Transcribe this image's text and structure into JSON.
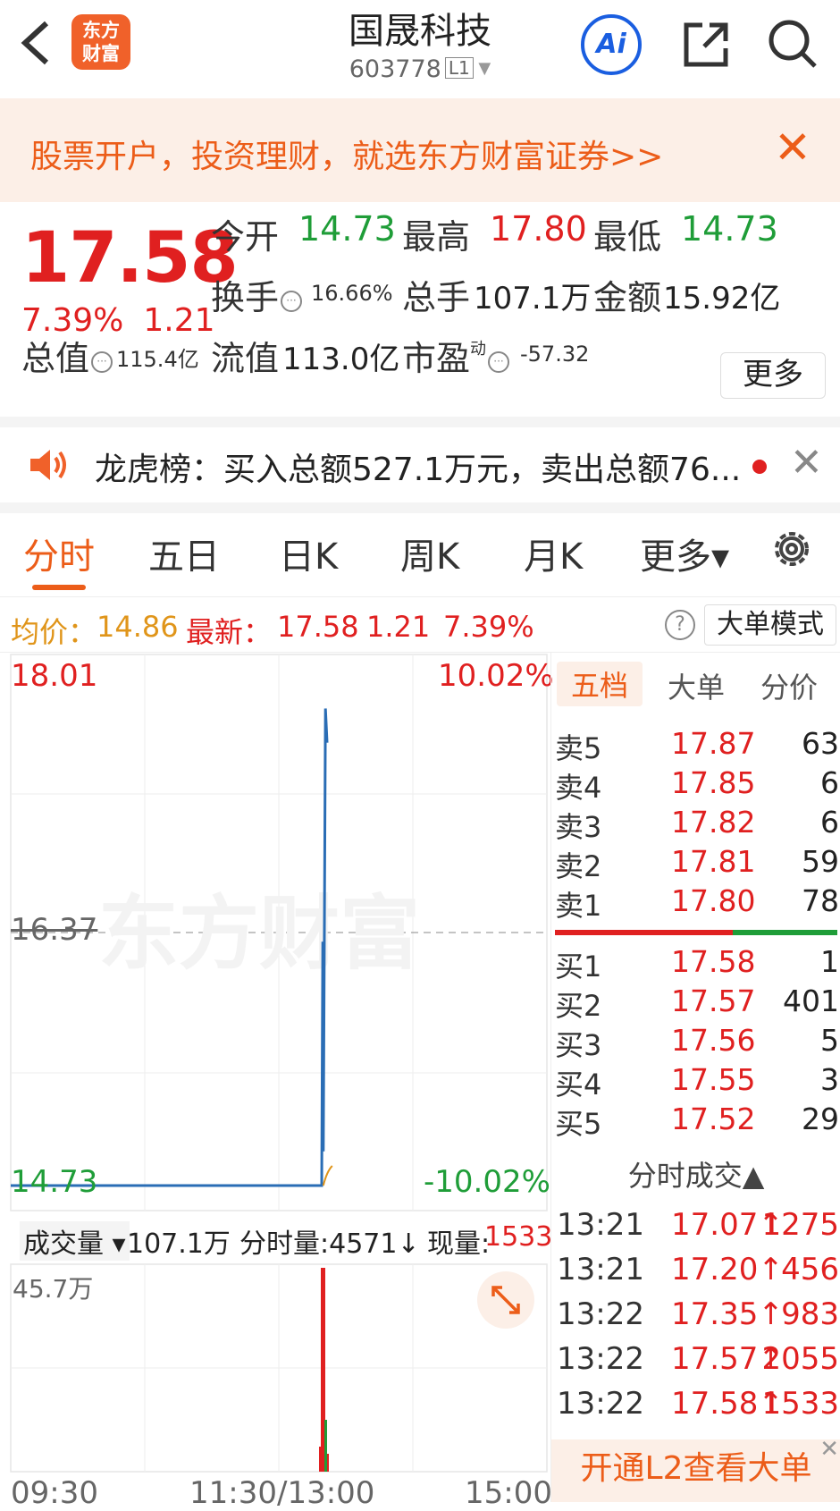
{
  "header": {
    "back_icon": "chevron-left-icon",
    "logo_line1": "东方",
    "logo_line2": "财富",
    "title": "国晟科技",
    "code": "603778",
    "level": "L1",
    "ai_label": "Ai"
  },
  "banner": {
    "text": "股票开户，投资理财，就选东方财富证券>>",
    "close": "✕"
  },
  "quote": {
    "price": "17.58",
    "pct": "7.39%",
    "change": "1.21",
    "open_label": "今开",
    "open": "14.73",
    "high_label": "最高",
    "high": "17.80",
    "low_label": "最低",
    "low": "14.73",
    "turnover_label": "换手",
    "turnover": "16.66%",
    "volume_label": "总手",
    "volume": "107.1万",
    "amount_label": "金额",
    "amount": "15.92亿",
    "mcap_label": "总值",
    "mcap": "115.4亿",
    "float_label": "流值",
    "float": "113.0亿",
    "pe_label": "市盈",
    "pe_sup": "动",
    "pe": "-57.32",
    "more": "更多"
  },
  "notice": {
    "text": "龙虎榜：买入总额527.1万元，卖出总额76...",
    "close": "✕"
  },
  "tabs": [
    "分时",
    "五日",
    "日K",
    "周K",
    "月K",
    "更多▾"
  ],
  "avg": {
    "avg_label": "均价：",
    "avg": "14.86",
    "latest_label": "最新：",
    "latest": "17.58",
    "change": "1.21",
    "pct": "7.39%",
    "help": "?",
    "bigmode": "大单模式"
  },
  "chart": {
    "y_top": "18.01",
    "y_mid": "16.37",
    "y_bottom": "14.73",
    "pct_top": "10.02%",
    "pct_bottom": "-10.02%",
    "vol_selector": "成交量 ▾",
    "vol_total": "107.1万",
    "vol_tick_label": "分时量:4571↓",
    "vol_now_label": "现量:",
    "vol_now": "1533",
    "vol_max": "45.7万",
    "x_start": "09:30",
    "x_mid": "11:30/13:00",
    "x_end": "15:00",
    "watermark": "东方财富"
  },
  "chart_data": {
    "type": "line",
    "ylim": [
      14.73,
      18.01
    ],
    "y_mid": 16.37,
    "x_range": [
      "09:30",
      "15:00"
    ],
    "note_series": "price",
    "price_points": [
      {
        "t": 0.0,
        "v": 14.73
      },
      {
        "t": 0.58,
        "v": 14.73
      },
      {
        "t": 0.582,
        "v": 16.3
      },
      {
        "t": 0.583,
        "v": 14.95
      },
      {
        "t": 0.587,
        "v": 17.8
      },
      {
        "t": 0.59,
        "v": 17.58
      }
    ],
    "volume_max": "45.7万"
  },
  "book": {
    "tabs": [
      "五档",
      "大单",
      "分价"
    ],
    "asks": [
      {
        "label": "卖5",
        "price": "17.87",
        "vol": "63"
      },
      {
        "label": "卖4",
        "price": "17.85",
        "vol": "6"
      },
      {
        "label": "卖3",
        "price": "17.82",
        "vol": "6"
      },
      {
        "label": "卖2",
        "price": "17.81",
        "vol": "59"
      },
      {
        "label": "卖1",
        "price": "17.80",
        "vol": "78"
      }
    ],
    "bids": [
      {
        "label": "买1",
        "price": "17.58",
        "vol": "1"
      },
      {
        "label": "买2",
        "price": "17.57",
        "vol": "401"
      },
      {
        "label": "买3",
        "price": "17.56",
        "vol": "5"
      },
      {
        "label": "买4",
        "price": "17.55",
        "vol": "3"
      },
      {
        "label": "买5",
        "price": "17.52",
        "vol": "29"
      }
    ],
    "trades_title": "分时成交▲",
    "trades": [
      {
        "time": "13:21",
        "price": "17.07↑",
        "vol": "1275"
      },
      {
        "time": "13:21",
        "price": "17.20↑",
        "vol": "456"
      },
      {
        "time": "13:22",
        "price": "17.35↑",
        "vol": "983"
      },
      {
        "time": "13:22",
        "price": "17.57↑",
        "vol": "2055"
      },
      {
        "time": "13:22",
        "price": "17.58↑",
        "vol": "1533"
      }
    ],
    "l2": "开通L2查看大单",
    "l2_close": "✕"
  },
  "colors": {
    "up": "#e02020",
    "down": "#1f9d38",
    "brand": "#ec5d19",
    "line": "#2a6db5"
  }
}
